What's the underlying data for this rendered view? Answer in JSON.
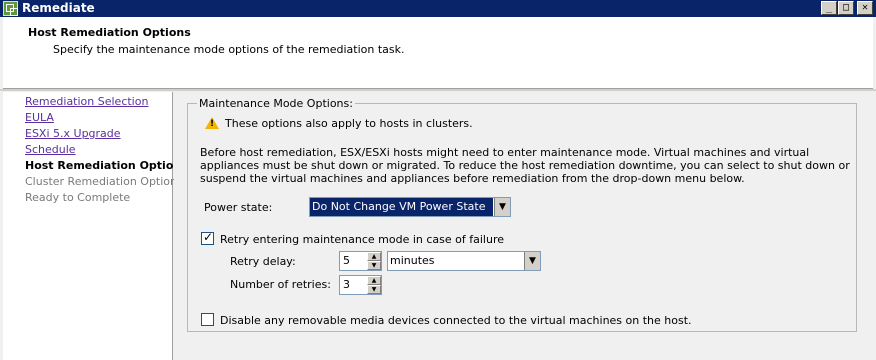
{
  "window": {
    "title": "Remediate"
  },
  "header": {
    "title": "Host Remediation Options",
    "subtitle": "Specify the maintenance mode options of the remediation task."
  },
  "nav": {
    "items": [
      {
        "label": "Remediation Selection",
        "state": "link"
      },
      {
        "label": "EULA",
        "state": "link"
      },
      {
        "label": "ESXi 5.x Upgrade",
        "state": "link"
      },
      {
        "label": "Schedule",
        "state": "link"
      },
      {
        "label": "Host Remediation Options",
        "state": "current"
      },
      {
        "label": "Cluster Remediation Options",
        "state": "disabled"
      },
      {
        "label": "Ready to Complete",
        "state": "disabled"
      }
    ]
  },
  "maintenance": {
    "legend": "Maintenance Mode Options:",
    "warning": "These options also apply to hosts in clusters.",
    "description": "Before host remediation, ESX/ESXi hosts might need to enter maintenance mode. Virtual machines and virtual appliances must be shut down or migrated. To reduce the host remediation downtime, you can select to shut down or suspend the virtual machines and appliances before remediation from the drop-down menu below.",
    "power_state_label": "Power state:",
    "power_state_value": "Do Not Change VM Power State",
    "retry_label": "Retry entering maintenance mode in case of failure",
    "retry_checked": true,
    "retry_delay_label": "Retry delay:",
    "retry_delay_value": "5",
    "retry_delay_unit": "minutes",
    "retries_label": "Number of retries:",
    "retries_value": "3",
    "disable_media_label": "Disable any removable media devices connected to the virtual machines on the host.",
    "disable_media_checked": false
  },
  "colors": {
    "titlebar": "#0a246a",
    "link": "#5a2fa0",
    "warning": "#f2b600"
  },
  "icons": {
    "app": "vmware-update-manager-icon",
    "warning": "warning-icon"
  }
}
